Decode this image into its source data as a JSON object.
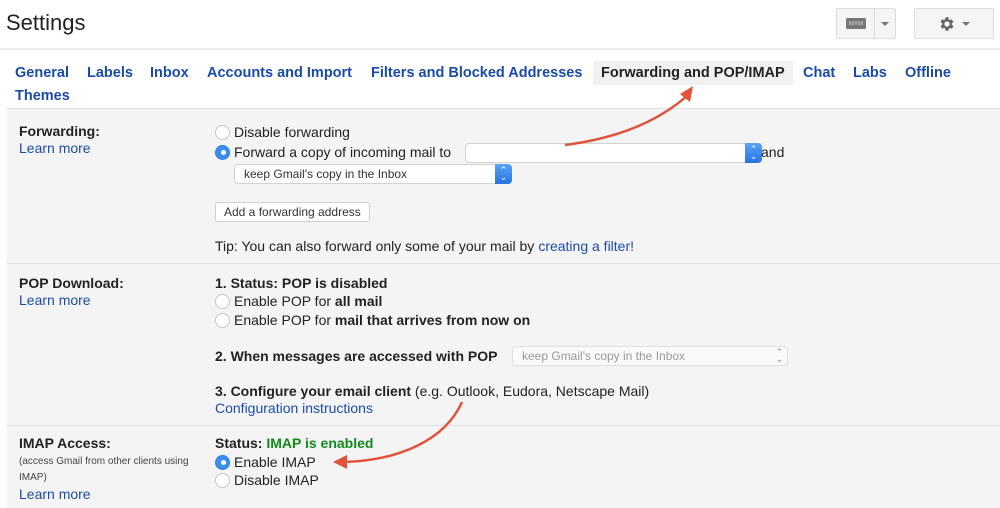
{
  "header": {
    "title": "Settings",
    "keyboard_button": "keyboard-icon",
    "settings_button": "gear-icon"
  },
  "tabs": [
    {
      "label": "General",
      "active": false
    },
    {
      "label": "Labels",
      "active": false
    },
    {
      "label": "Inbox",
      "active": false
    },
    {
      "label": "Accounts and Import",
      "active": false
    },
    {
      "label": "Filters and Blocked Addresses",
      "active": false
    },
    {
      "label": "Forwarding and POP/IMAP",
      "active": true
    },
    {
      "label": "Chat",
      "active": false
    },
    {
      "label": "Labs",
      "active": false
    },
    {
      "label": "Offline",
      "active": false
    },
    {
      "label": "Themes",
      "active": false
    }
  ],
  "forwarding": {
    "label": "Forwarding:",
    "learn_more": "Learn more",
    "option_disable": "Disable forwarding",
    "option_forward": "Forward a copy of incoming mail to",
    "forward_selected": true,
    "address_value": "",
    "and_text": "and",
    "action_select": "keep Gmail's copy in the Inbox",
    "add_button": "Add a forwarding address",
    "tip_text": "Tip: You can also forward only some of your mail by ",
    "tip_link": "creating a filter!"
  },
  "pop": {
    "label": "POP Download:",
    "learn_more": "Learn more",
    "status_prefix": "1. Status: ",
    "status_value": "POP is disabled",
    "option_all_prefix": "Enable POP for ",
    "option_all_bold": "all mail",
    "option_now_prefix": "Enable POP for ",
    "option_now_bold": "mail that arrives from now on",
    "step2_label": "2. When messages are accessed with POP",
    "step2_select": "keep Gmail's copy in the Inbox",
    "step3_bold": "3. Configure your email client",
    "step3_rest": " (e.g. Outlook, Eudora, Netscape Mail)",
    "config_link": "Configuration instructions"
  },
  "imap": {
    "label": "IMAP Access:",
    "sub_note": "(access Gmail from other clients using IMAP)",
    "learn_more": "Learn more",
    "status_prefix": "Status: ",
    "status_value": "IMAP is enabled",
    "option_enable": "Enable IMAP",
    "option_disable": "Disable IMAP",
    "enabled": true
  },
  "colors": {
    "link": "#1a4ba6",
    "status_green": "#128a1e",
    "radio_selected": "#3b8df0",
    "annotation_arrow": "#e0533a"
  }
}
